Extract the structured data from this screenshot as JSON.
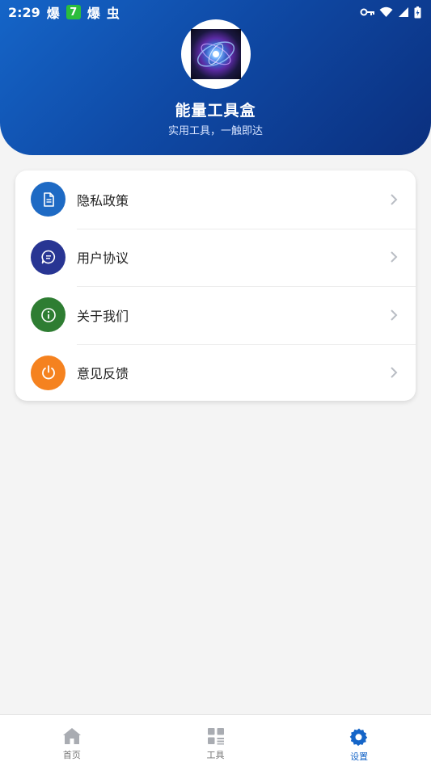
{
  "status_bar": {
    "time": "2:29",
    "notification_1": "爆",
    "notification_badge": "7",
    "notification_2": "爆",
    "notification_3": "虫"
  },
  "profile": {
    "app_name": "能量工具盒",
    "slogan": "实用工具，一触即达"
  },
  "menu": {
    "items": [
      {
        "label": "隐私政策",
        "icon": "document-icon",
        "color": "#1e6ac4"
      },
      {
        "label": "用户协议",
        "icon": "chat-icon",
        "color": "#283593"
      },
      {
        "label": "关于我们",
        "icon": "info-icon",
        "color": "#2e7d32"
      },
      {
        "label": "意见反馈",
        "icon": "power-icon",
        "color": "#f5821f"
      }
    ]
  },
  "tabbar": {
    "tabs": [
      {
        "label": "首页",
        "icon": "home-icon",
        "active": false
      },
      {
        "label": "工具",
        "icon": "grid-icon",
        "active": false
      },
      {
        "label": "设置",
        "icon": "gear-icon",
        "active": true
      }
    ]
  },
  "colors": {
    "header_start": "#1565c8",
    "header_end": "#0b2f7e",
    "active_tab": "#1565c8"
  }
}
